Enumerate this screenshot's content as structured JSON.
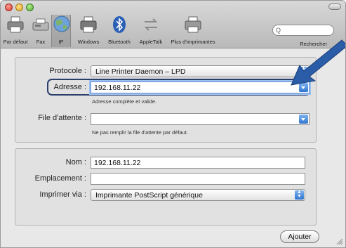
{
  "toolbar": {
    "items": [
      {
        "label": "Par défaut",
        "icon": "printer-icon"
      },
      {
        "label": "Fax",
        "icon": "fax-icon"
      },
      {
        "label": "IP",
        "icon": "globe-icon"
      },
      {
        "label": "Windows",
        "icon": "windows-printer-icon"
      },
      {
        "label": "Bluetooth",
        "icon": "bluetooth-icon"
      },
      {
        "label": "AppleTalk",
        "icon": "appletalk-icon"
      },
      {
        "label": "Plus d'imprimantes",
        "icon": "more-printers-icon"
      }
    ],
    "search": {
      "placeholder": "Q",
      "label": "Rechercher"
    }
  },
  "form1": {
    "protocol_label": "Protocole :",
    "protocol_value": "Line Printer Daemon – LPD",
    "address_label": "Adresse :",
    "address_value": "192.168.11.22",
    "address_hint": "Adresse complète et valide.",
    "queue_label": "File d'attente :",
    "queue_value": "",
    "queue_hint": "Ne pas remplir la file d'attente par défaut."
  },
  "form2": {
    "name_label": "Nom :",
    "name_value": "192.168.11.22",
    "location_label": "Emplacement :",
    "location_value": "",
    "print_via_label": "Imprimer via :",
    "print_via_value": "Imprimante PostScript générique"
  },
  "actions": {
    "add_label": "Ajouter"
  },
  "colors": {
    "accent": "#2f74cf",
    "arrow": "#2a5ca8",
    "highlight": "#2c3f6c"
  }
}
